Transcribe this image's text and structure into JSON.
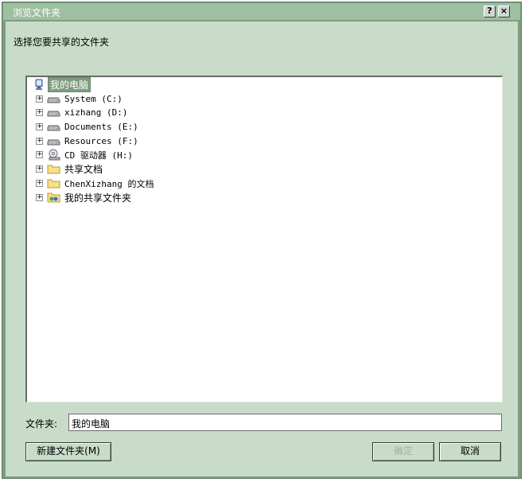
{
  "window": {
    "title": "浏览文件夹",
    "help_label": "?",
    "close_label": "×"
  },
  "prompt": "选择您要共享的文件夹",
  "tree": {
    "root": {
      "label": "我的电脑",
      "icon": "my-computer-icon",
      "selected": true
    },
    "items": [
      {
        "label": "System (C:)",
        "icon": "hard-drive-icon",
        "expander": "+"
      },
      {
        "label": "xizhang (D:)",
        "icon": "hard-drive-icon",
        "expander": "+"
      },
      {
        "label": "Documents (E:)",
        "icon": "hard-drive-icon",
        "expander": "+"
      },
      {
        "label": "Resources (F:)",
        "icon": "hard-drive-icon",
        "expander": "+"
      },
      {
        "label": "CD 驱动器 (H:)",
        "icon": "cd-drive-icon",
        "expander": "+"
      },
      {
        "label": "共享文档",
        "icon": "folder-icon",
        "expander": "+"
      },
      {
        "label": "ChenXizhang 的文档",
        "icon": "folder-icon",
        "expander": "+"
      },
      {
        "label": "我的共享文件夹",
        "icon": "shared-folder-icon",
        "expander": "+"
      }
    ]
  },
  "folder_field": {
    "label": "文件夹:",
    "value": "我的电脑"
  },
  "buttons": {
    "new_folder": "新建文件夹(M)",
    "ok": "确定",
    "cancel": "取消"
  },
  "colors": {
    "accent": "#7e9d80",
    "titlebar": "#9fbfa2",
    "client_bg": "#c8dcc9"
  }
}
